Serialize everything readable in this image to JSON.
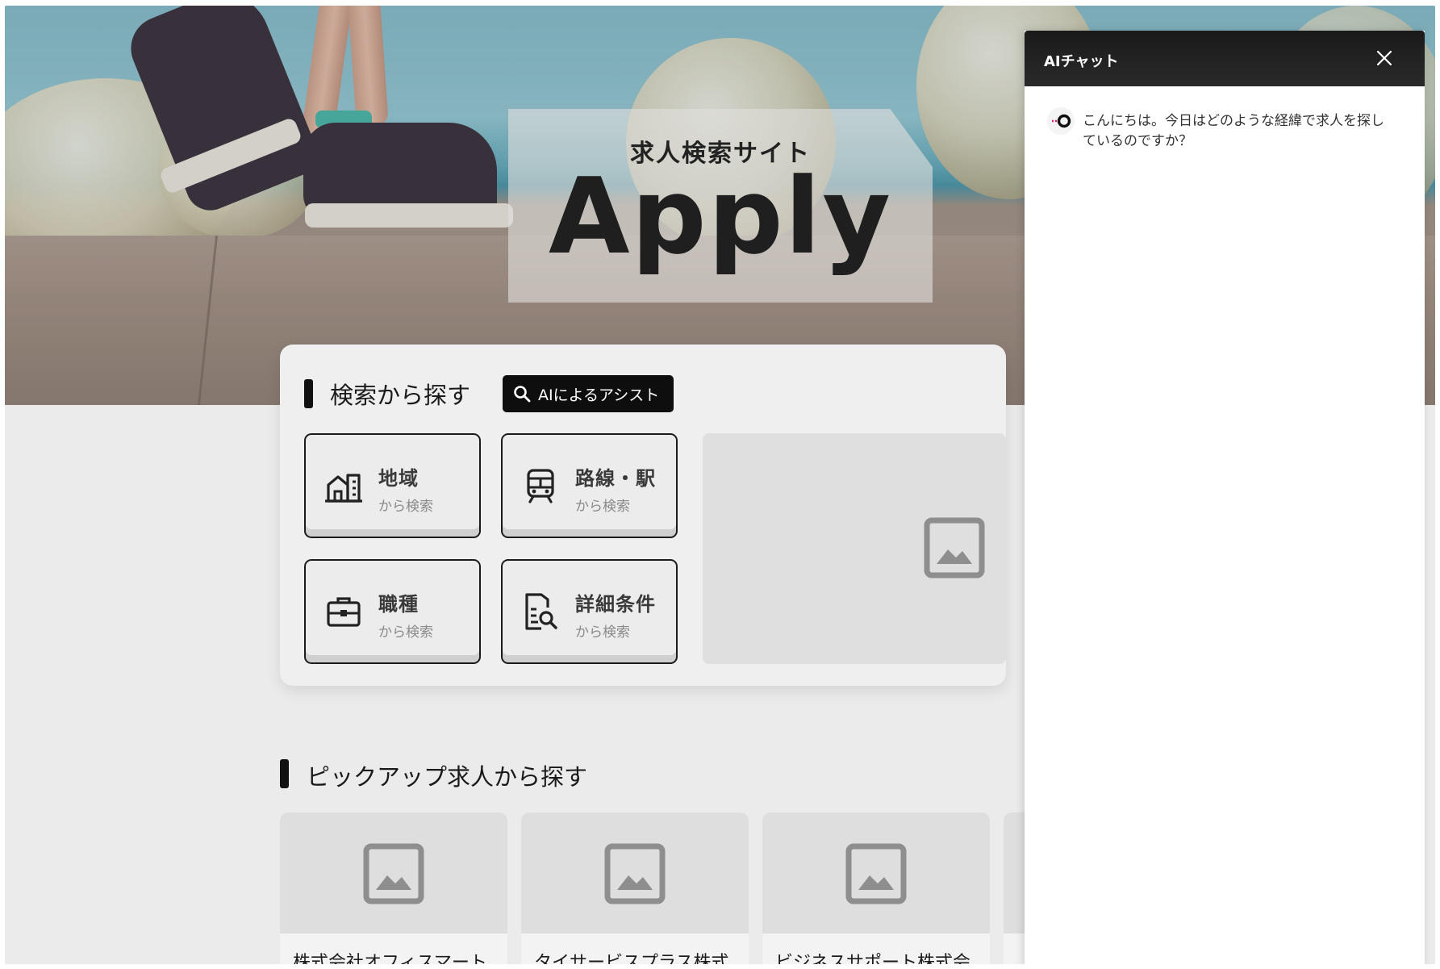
{
  "hero": {
    "subtitle": "求人検索サイト",
    "brand": "Apply"
  },
  "search": {
    "title": "検索から探す",
    "ai_assist_label": "AIによるアシスト",
    "categories": [
      {
        "main": "地域",
        "sub": "から検索",
        "icon": "building-icon"
      },
      {
        "main": "路線・駅",
        "sub": "から検索",
        "icon": "train-icon"
      },
      {
        "main": "職種",
        "sub": "から検索",
        "icon": "briefcase-icon"
      },
      {
        "main": "詳細条件",
        "sub": "から検索",
        "icon": "document-search-icon"
      }
    ]
  },
  "pickup": {
    "title": "ピックアップ求人から探す",
    "jobs": [
      {
        "company": "株式会社オフィスマート"
      },
      {
        "company": "タイサービスプラス株式"
      },
      {
        "company": "ビジネスサポート株式会"
      }
    ]
  },
  "chat": {
    "title": "AIチャット",
    "messages": [
      {
        "text": "こんにちは。今日はどのような経緯で求人を探しているのですか？"
      }
    ]
  },
  "colors": {
    "accent": "#111111",
    "chat_header": "#1e1e1e"
  }
}
